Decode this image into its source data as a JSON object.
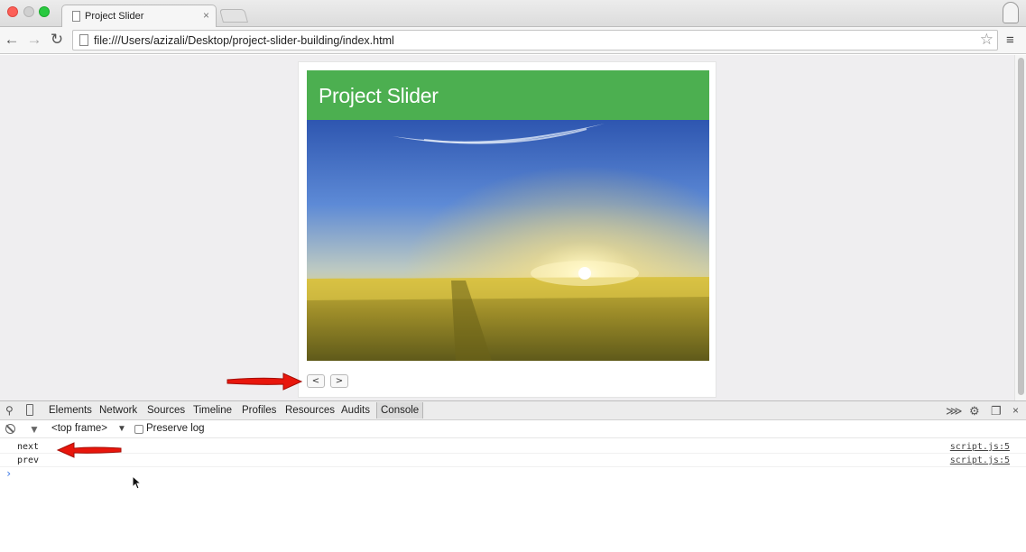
{
  "browser": {
    "tab_title": "Project Slider",
    "tab_close": "×",
    "url": "file:///Users/azizali/Desktop/project-slider-building/index.html",
    "icons": {
      "back": "←",
      "forward": "→",
      "reload": "↻",
      "bookmark": "☆",
      "menu": "≡"
    }
  },
  "slider": {
    "title": "Project Slider",
    "header_color": "#4caf50",
    "image_description_icon": "sunrise-field-image",
    "prev_label": "<",
    "next_label": ">"
  },
  "devtools": {
    "tabs": [
      "Elements",
      "Network",
      "Sources",
      "Timeline",
      "Profiles",
      "Resources",
      "Audits",
      "Console"
    ],
    "active_tab": "Console",
    "frame_selector": "<top frame>",
    "frame_caret": "▼",
    "preserve_log_label": "Preserve log",
    "preserve_log_checked": false,
    "console_lines": [
      {
        "message": "next",
        "source": "script.js:5"
      },
      {
        "message": "prev",
        "source": "script.js:5"
      }
    ],
    "prompt": "›"
  },
  "annotations": {
    "arrow_color": "#e8160c"
  }
}
